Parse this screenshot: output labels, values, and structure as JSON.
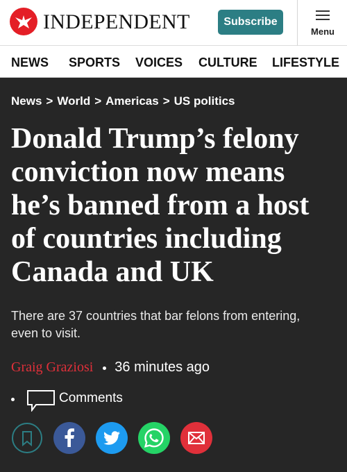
{
  "header": {
    "brand": "INDEPENDENT",
    "subscribe_label": "Subscribe",
    "menu_label": "Menu"
  },
  "nav": {
    "items": [
      "NEWS",
      "SPORTS",
      "VOICES",
      "CULTURE",
      "LIFESTYLE"
    ]
  },
  "breadcrumb": [
    "News",
    "World",
    "Americas",
    "US politics"
  ],
  "article": {
    "headline": "Donald Trump’s felony conviction now means he’s banned from a host of countries including Canada and UK",
    "standfirst": "There are 37 countries that bar felons from entering, even to visit.",
    "author": "Graig Graziosi",
    "time": "36 minutes ago",
    "comments_label": "Comments"
  },
  "share": {
    "icons": [
      "bookmark-icon",
      "facebook-icon",
      "twitter-icon",
      "whatsapp-icon",
      "email-icon"
    ]
  },
  "colors": {
    "brand_red": "#e41e26",
    "subscribe": "#2c7e84",
    "background": "#262626",
    "author": "#e0303a",
    "bookmark": "#2c7e84",
    "facebook": "#3b5998",
    "twitter": "#1d9bf0",
    "whatsapp": "#25d366",
    "email": "#e0303a"
  }
}
